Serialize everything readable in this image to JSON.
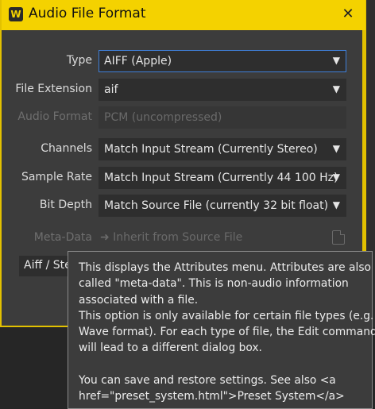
{
  "titlebar": {
    "title": "Audio File Format",
    "app_icon": "W",
    "close": "✕"
  },
  "fields": {
    "type": {
      "label": "Type",
      "value": "AIFF (Apple)"
    },
    "file_extension": {
      "label": "File Extension",
      "value": "aif"
    },
    "audio_format": {
      "label": "Audio Format",
      "value": "PCM (uncompressed)"
    },
    "channels": {
      "label": "Channels",
      "value": "Match Input Stream (Currently Stereo)"
    },
    "sample_rate": {
      "label": "Sample Rate",
      "value": "Match Input Stream (Currently 44 100 Hz)"
    },
    "bit_depth": {
      "label": "Bit Depth",
      "value": "Match Source File (currently 32 bit float)"
    },
    "meta_data": {
      "label": "Meta-Data",
      "value": "➜ Inherit from Source File"
    }
  },
  "preset": {
    "value": "Aiff / Ste"
  },
  "dropdown_arrow": "▼",
  "tooltip": {
    "lines": [
      "This displays the Attributes menu. Attributes are also",
      "called \"meta-data\". This is non-audio information",
      "associated with a file.",
      "This option is only available for certain file types (e.g.",
      "Wave format). For each type of file, the Edit command",
      "will lead to a different dialog box.",
      "",
      "You can save and restore settings. See also <a",
      "href=\"preset_system.html\">Preset System</a>"
    ]
  }
}
